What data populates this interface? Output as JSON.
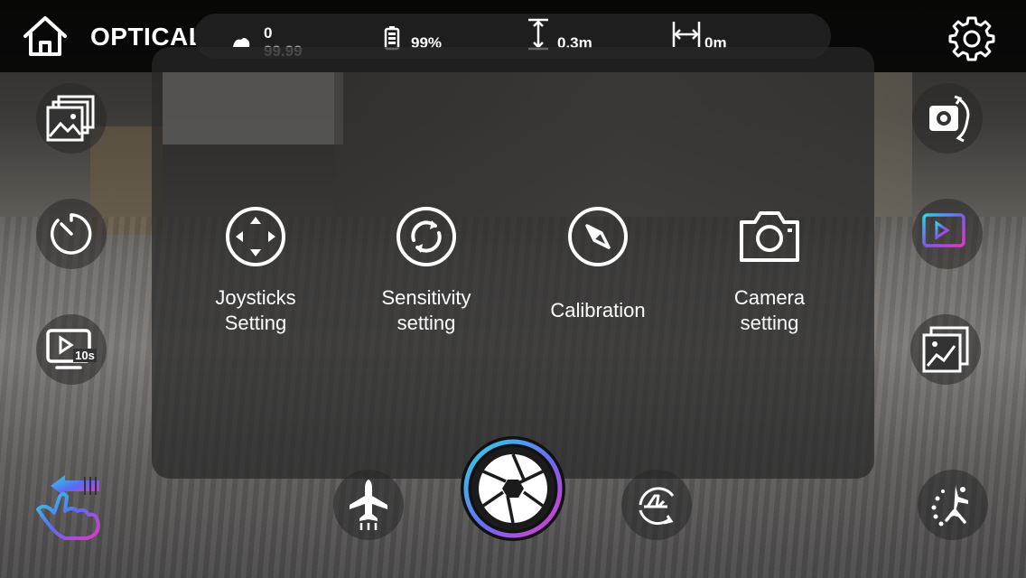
{
  "topbar": {
    "mode": "OPTICAL",
    "signal_value": "0",
    "signal_sub": "99.99",
    "battery": "99%",
    "height": "0.3m",
    "distance": "0m"
  },
  "panel": {
    "options": [
      {
        "label": "Joysticks\nSetting",
        "icon": "joystick-icon"
      },
      {
        "label": "Sensitivity\nsetting",
        "icon": "sensitivity-icon"
      },
      {
        "label": "Calibration",
        "icon": "compass-icon"
      },
      {
        "label": "Camera\nsetting",
        "icon": "camera-icon"
      }
    ]
  },
  "left_buttons": [
    "gallery-icon",
    "timer-icon",
    "video-10s-icon",
    "swipe-gesture-icon"
  ],
  "right_buttons": [
    "camera-flip-icon",
    "screen-cast-icon",
    "photo-album-icon",
    "flight-mode-icon"
  ],
  "bottom_buttons": [
    "takeoff-icon",
    "shutter-icon",
    "land-icon"
  ],
  "timer_badge": "10s",
  "colors": {
    "accent_cyan": "#2fd4e8",
    "accent_magenta": "#e536c8",
    "text": "#ffffff"
  }
}
